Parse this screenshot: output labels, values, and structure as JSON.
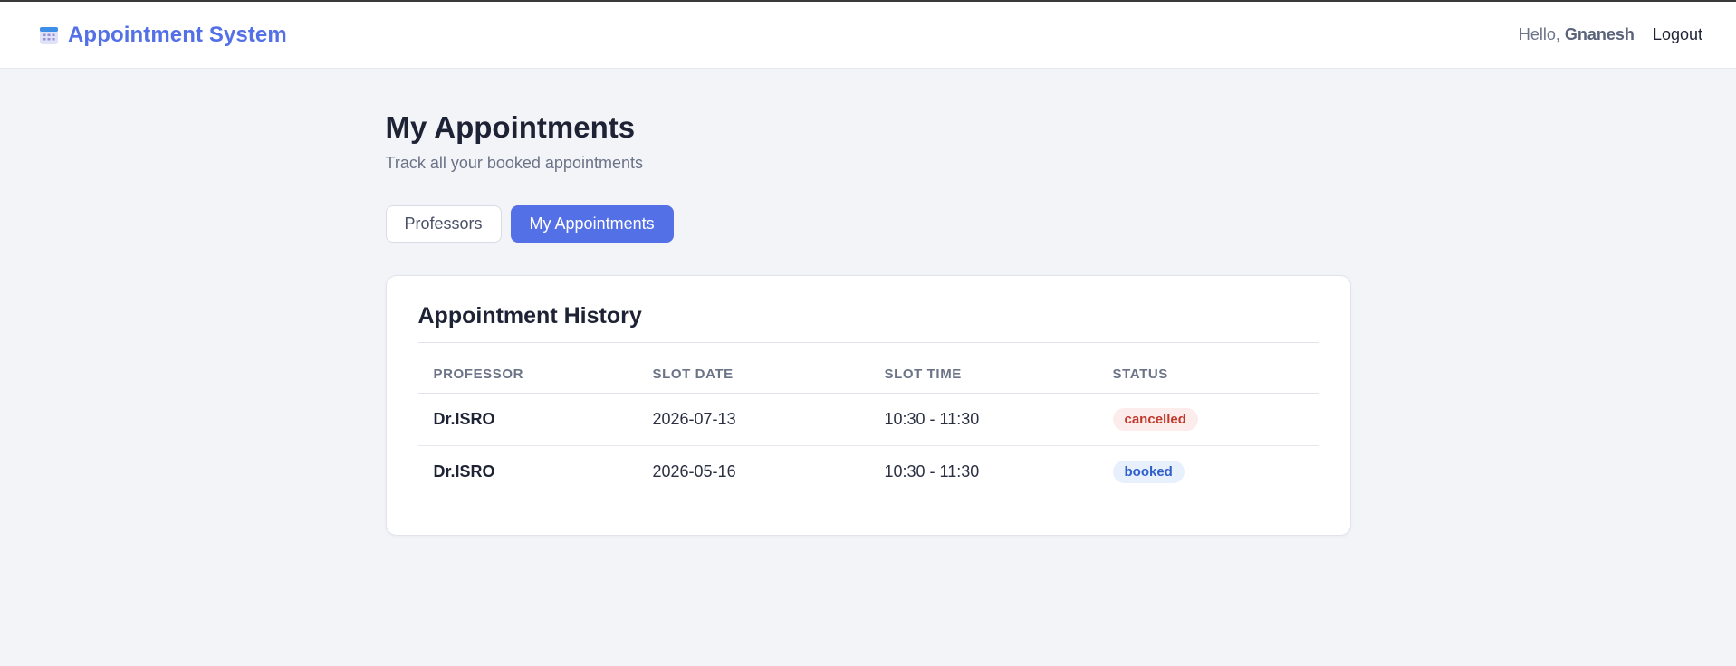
{
  "navbar": {
    "brand_icon": "calendar-icon",
    "brand_title": "Appointment System",
    "greeting_prefix": "Hello,",
    "username": "Gnanesh",
    "logout_label": "Logout"
  },
  "page": {
    "title": "My Appointments",
    "subtitle": "Track all your booked appointments"
  },
  "tabs": [
    {
      "label": "Professors",
      "active": false
    },
    {
      "label": "My Appointments",
      "active": true
    }
  ],
  "history": {
    "title": "Appointment History",
    "columns": [
      "PROFESSOR",
      "SLOT DATE",
      "SLOT TIME",
      "STATUS"
    ],
    "rows": [
      {
        "professor": "Dr.ISRO",
        "date": "2026-07-13",
        "time": "10:30 - 11:30",
        "status": "cancelled"
      },
      {
        "professor": "Dr.ISRO",
        "date": "2026-05-16",
        "time": "10:30 - 11:30",
        "status": "booked"
      }
    ]
  },
  "colors": {
    "accent": "#5470e6",
    "status_cancelled": "#c0392b",
    "status_booked": "#2f5fc8"
  }
}
